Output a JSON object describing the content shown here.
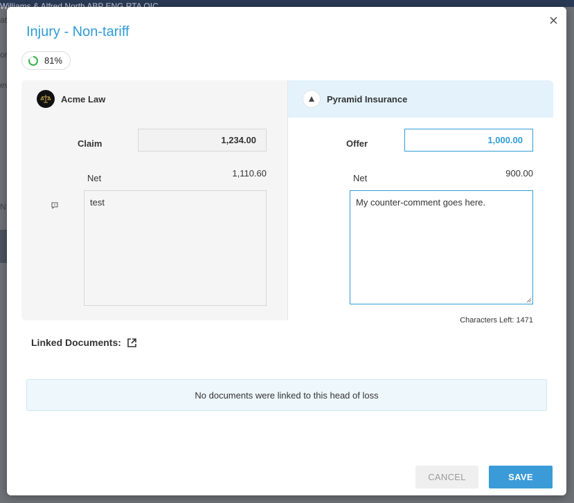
{
  "background": {
    "header_text": "Williams & Alfred North        ABP  ENG  RTA  OIC",
    "frag_at": "at",
    "frag_or": "or",
    "frag_ev": "ev",
    "frag_n": "N"
  },
  "modal": {
    "title": "Injury - Non-tariff",
    "progress": {
      "value": 81,
      "label": "81%"
    },
    "close_icon": "close-icon"
  },
  "left_party": {
    "name": "Acme Law",
    "claim_label": "Claim",
    "claim_value": "1,234.00",
    "net_label": "Net",
    "net_value": "1,110.60",
    "comment": "test"
  },
  "right_party": {
    "name": "Pyramid Insurance",
    "offer_label": "Offer",
    "offer_value": "1,000.00",
    "net_label": "Net",
    "net_value": "900.00",
    "comment": "My counter-comment goes here.",
    "chars_left": "Characters Left: 1471"
  },
  "linked_documents": {
    "heading": "Linked Documents:",
    "empty_message": "No documents were linked to this head of loss"
  },
  "actions": {
    "cancel_label": "CANCEL",
    "save_label": "SAVE"
  },
  "colors": {
    "accent": "#2f9bd6",
    "progress": "#35b34a",
    "right_header_bg": "#e3f2fb"
  }
}
